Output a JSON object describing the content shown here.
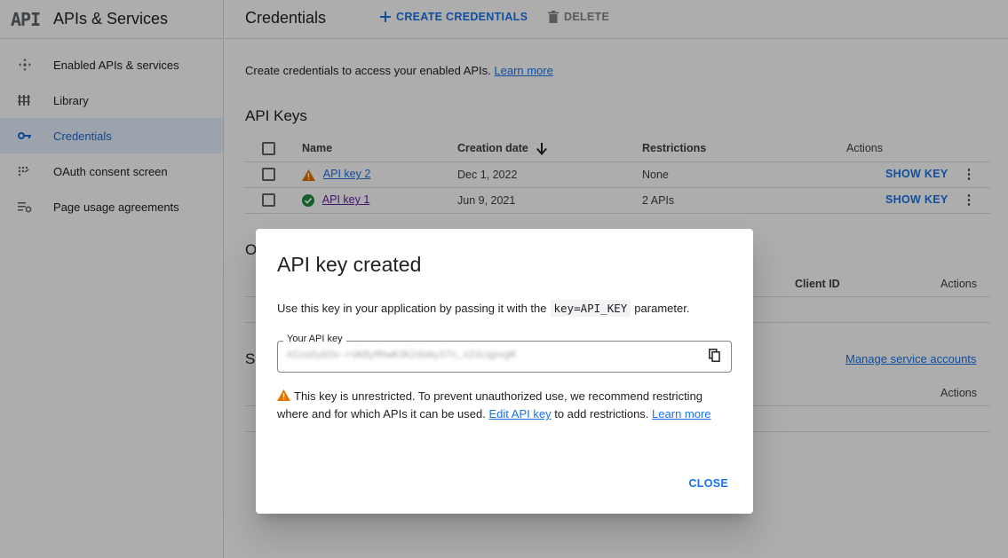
{
  "sidebar": {
    "logo": "API",
    "title": "APIs & Services",
    "items": [
      {
        "label": "Enabled APIs & services",
        "icon": "enabled-apis-icon"
      },
      {
        "label": "Library",
        "icon": "library-icon"
      },
      {
        "label": "Credentials",
        "icon": "key-icon",
        "active": true
      },
      {
        "label": "OAuth consent screen",
        "icon": "oauth-icon"
      },
      {
        "label": "Page usage agreements",
        "icon": "settings-list-icon"
      }
    ]
  },
  "header": {
    "title": "Credentials",
    "create_label": "CREATE CREDENTIALS",
    "delete_label": "DELETE"
  },
  "main": {
    "intro_text": "Create credentials to access your enabled APIs.",
    "intro_link": "Learn more",
    "api_keys": {
      "title": "API Keys",
      "columns": [
        "Name",
        "Creation date",
        "Restrictions",
        "Actions"
      ],
      "rows": [
        {
          "name": "API key 2",
          "status": "warning",
          "date": "Dec 1, 2022",
          "restrictions": "None",
          "action": "SHOW KEY"
        },
        {
          "name": "API key 1",
          "status": "ok",
          "date": "Jun 9, 2021",
          "restrictions": "2 APIs",
          "action": "SHOW KEY"
        }
      ]
    },
    "oauth_partial_title": "O",
    "oauth_columns": {
      "client_id": "Client ID",
      "actions": "Actions"
    },
    "service_partial_title": "S",
    "service_actions": "Actions",
    "manage_link": "Manage service accounts"
  },
  "dialog": {
    "title": "API key created",
    "text_before": "Use this key in your application by passing it with the",
    "code": "key=API_KEY",
    "text_after": "parameter.",
    "field_label": "Your API key",
    "key_value": "AIzaSyD3v-rUK8yMhwK3K2dUAy37n_xZ3cqpvgM",
    "warning_text": "This key is unrestricted. To prevent unauthorized use, we recommend restricting where and for which APIs it can be used.",
    "edit_link": "Edit API key",
    "after_edit": "to add restrictions.",
    "learn_more": "Learn more",
    "close_label": "CLOSE"
  },
  "colors": {
    "accent": "#1a73e8",
    "warning": "#e37400",
    "success": "#1e8e3e",
    "visited": "#681da8"
  }
}
